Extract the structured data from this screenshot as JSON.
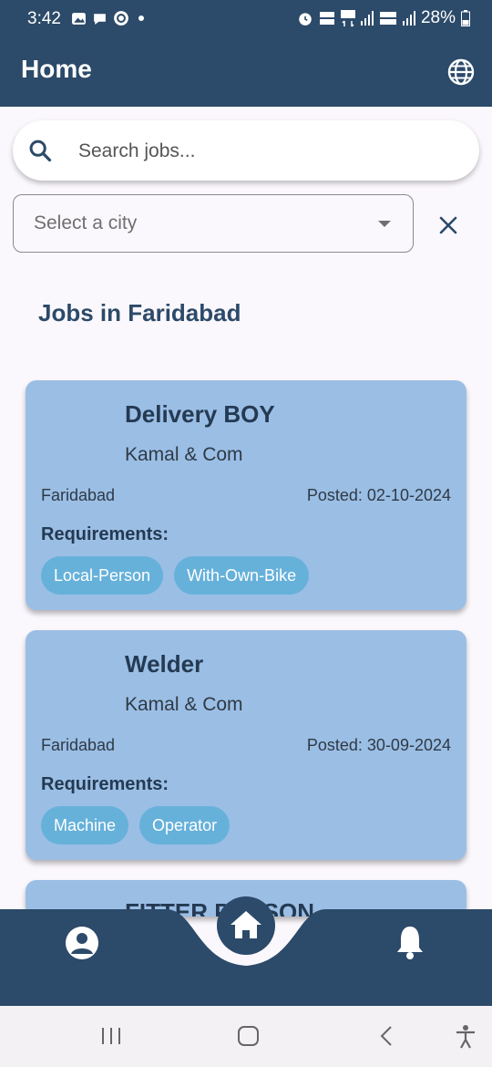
{
  "status_bar": {
    "time": "3:42",
    "battery": "28%",
    "left_icons": [
      "image-icon",
      "chat-icon",
      "sync-icon",
      "dot-icon"
    ],
    "right_icons": [
      "alarm-icon",
      "volte-5g-icon",
      "5g-icon",
      "signal-icon",
      "volte-lte-icon",
      "signal-icon",
      "battery-icon"
    ]
  },
  "appbar": {
    "title": "Home",
    "action_icon": "globe-icon"
  },
  "search": {
    "placeholder": "Search jobs...",
    "icon": "search-icon"
  },
  "city_select": {
    "placeholder": "Select a city",
    "clear_icon": "close-icon"
  },
  "section_title": "Jobs in Faridabad",
  "jobs": [
    {
      "title": "Delivery BOY",
      "company": "Kamal & Com",
      "city": "Faridabad",
      "posted": "Posted: 02-10-2024",
      "requirements_label": "Requirements:",
      "tags": [
        "Local-Person",
        "With-Own-Bike"
      ]
    },
    {
      "title": "Welder",
      "company": "Kamal & Com",
      "city": "Faridabad",
      "posted": "Posted: 30-09-2024",
      "requirements_label": "Requirements:",
      "tags": [
        "Machine",
        "Operator"
      ]
    },
    {
      "title": "FITTER PERSON"
    }
  ],
  "bottom_nav": {
    "items": [
      "profile-icon",
      "home-icon",
      "bell-icon"
    ],
    "background": "#2c4a69"
  },
  "system_nav": [
    "recents-icon",
    "home-circle-icon",
    "back-icon",
    "accessibility-icon"
  ],
  "colors": {
    "primary": "#2c4a69",
    "card": "#9bbee5",
    "tag": "#66b1da",
    "background": "#fbf8fd"
  }
}
